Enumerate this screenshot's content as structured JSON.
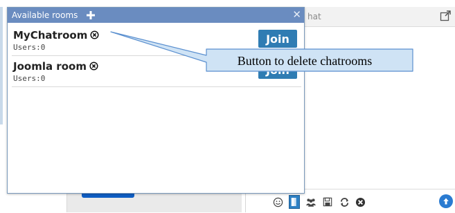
{
  "popup": {
    "title": "Available rooms",
    "add_icon": "plus-icon",
    "close_icon": "close-x-icon",
    "rooms": [
      {
        "name": "MyChatroom",
        "users": "Users:0",
        "join_label": "Join"
      },
      {
        "name": "Joomla room",
        "users": "Users:0",
        "join_label": "Join"
      }
    ]
  },
  "chat": {
    "title_fragment": "hat",
    "toolbar_icons": [
      "emoji-icon",
      "rooms-icon",
      "users-icon",
      "save-icon",
      "refresh-icon",
      "delete-icon"
    ],
    "upload_icon": "upload-icon"
  },
  "callout": {
    "text": "Button to delete chatrooms"
  },
  "colors": {
    "popup_header": "#6a8cc0",
    "join_button": "#2f7cb3",
    "callout_fill": "#cfe3f5",
    "callout_border": "#5a8fcf"
  }
}
